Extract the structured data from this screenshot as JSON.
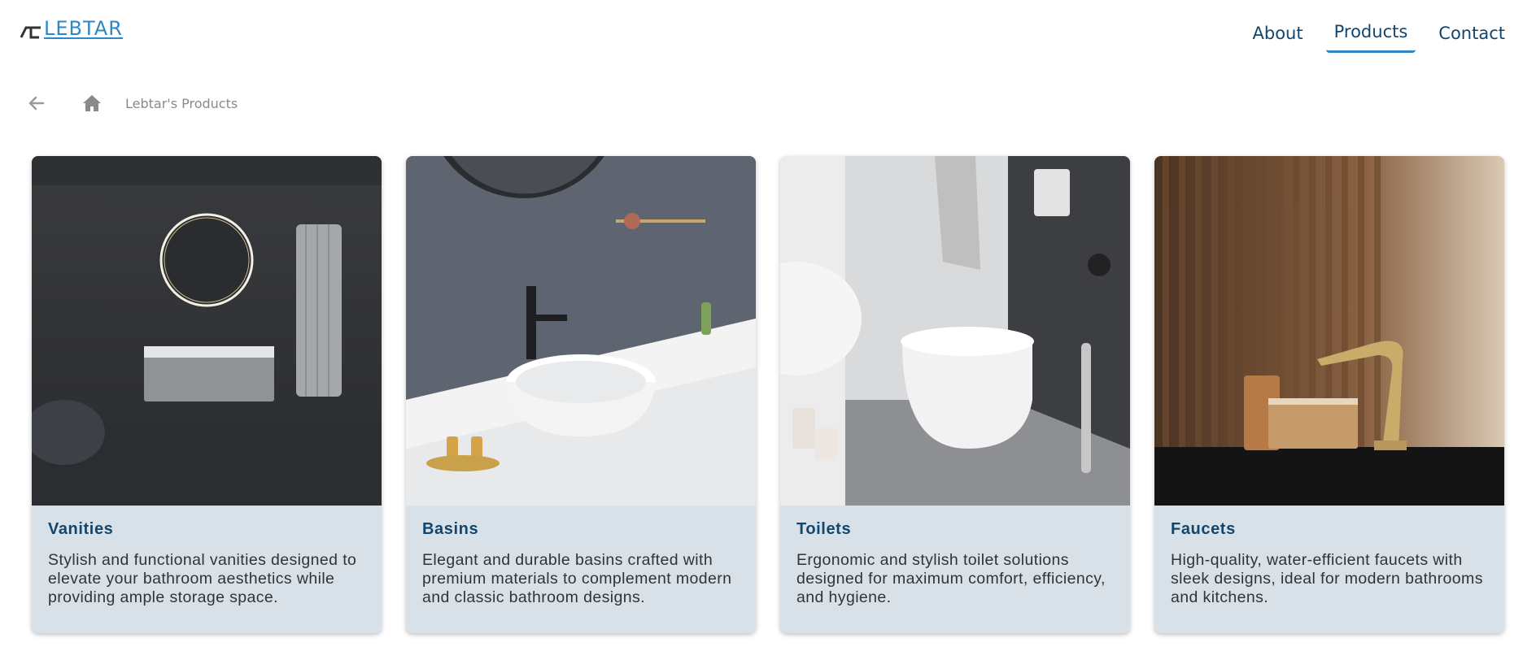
{
  "brand": {
    "name": "LEBTAR",
    "accent": "#2f87c5",
    "dark": "#11466e"
  },
  "nav": {
    "items": [
      {
        "label": "About",
        "active": false
      },
      {
        "label": "Products",
        "active": true
      },
      {
        "label": "Contact",
        "active": false
      }
    ]
  },
  "breadcrumb": {
    "back_icon": "arrow-left-icon",
    "home_icon": "home-icon",
    "label": "Lebtar's Products"
  },
  "products": [
    {
      "title": "Vanities",
      "description": "Stylish and functional vanities designed to elevate your bathroom aesthetics while providing ample storage space."
    },
    {
      "title": "Basins",
      "description": "Elegant and durable basins crafted with premium materials to complement modern and classic bathroom designs."
    },
    {
      "title": "Toilets",
      "description": "Ergonomic and stylish toilet solutions designed for maximum comfort, efficiency, and hygiene."
    },
    {
      "title": "Faucets",
      "description": "High-quality, water-efficient faucets with sleek designs, ideal for modern bathrooms and kitchens."
    }
  ]
}
